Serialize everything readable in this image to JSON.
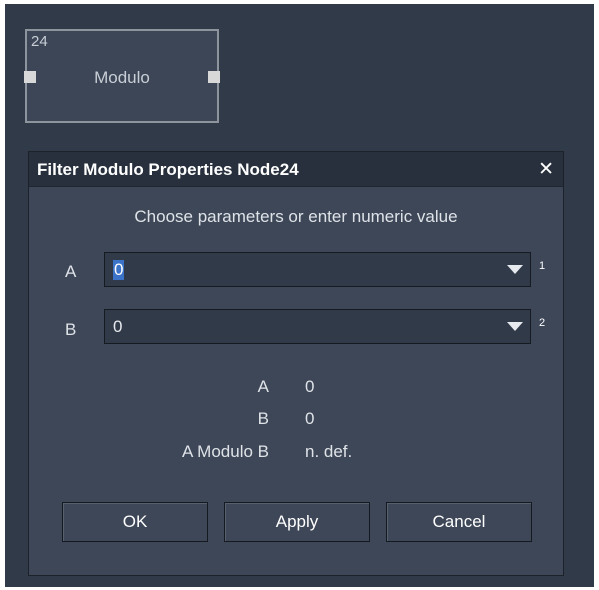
{
  "node": {
    "id": "24",
    "title": "Modulo"
  },
  "dialog": {
    "title": "Filter Modulo Properties Node24",
    "close_glyph": "✕",
    "hint": "Choose parameters or enter numeric value",
    "params": [
      {
        "label": "A",
        "value": "0",
        "index": "1"
      },
      {
        "label": "B",
        "value": "0",
        "index": "2"
      }
    ],
    "summary": [
      {
        "label": "A",
        "value": "0"
      },
      {
        "label": "B",
        "value": "0"
      },
      {
        "label": "A Modulo B",
        "value": "n. def."
      }
    ],
    "buttons": {
      "ok": "OK",
      "apply": "Apply",
      "cancel": "Cancel"
    }
  },
  "colors": {
    "canvas": "#313a49",
    "dialog": "#3d4757",
    "titlebar": "#28303d",
    "selection": "#3a73c7"
  }
}
